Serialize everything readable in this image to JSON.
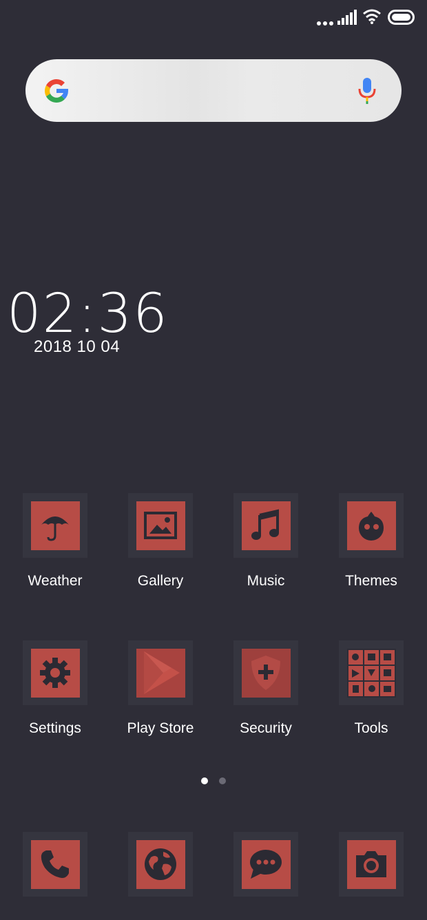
{
  "clock": {
    "time": "02:36",
    "date": "2018 10 04"
  },
  "apps_row1": [
    {
      "label": "Weather",
      "icon": "umbrella-icon"
    },
    {
      "label": "Gallery",
      "icon": "image-icon"
    },
    {
      "label": "Music",
      "icon": "music-note-icon"
    },
    {
      "label": "Themes",
      "icon": "themes-icon"
    }
  ],
  "apps_row2": [
    {
      "label": "Settings",
      "icon": "gear-icon"
    },
    {
      "label": "Play Store",
      "icon": "play-triangle-icon"
    },
    {
      "label": "Security",
      "icon": "shield-icon"
    },
    {
      "label": "Tools",
      "icon": "tools-grid-icon"
    }
  ],
  "dock": [
    {
      "icon": "phone-icon"
    },
    {
      "icon": "globe-icon"
    },
    {
      "icon": "chat-bubble-icon"
    },
    {
      "icon": "camera-icon"
    }
  ],
  "pager": {
    "pages": 2,
    "active": 1
  },
  "colors": {
    "background": "#2e2d37",
    "tile": "#35353f",
    "accent": "#b74c46",
    "icon_dark": "#2b2a33"
  }
}
